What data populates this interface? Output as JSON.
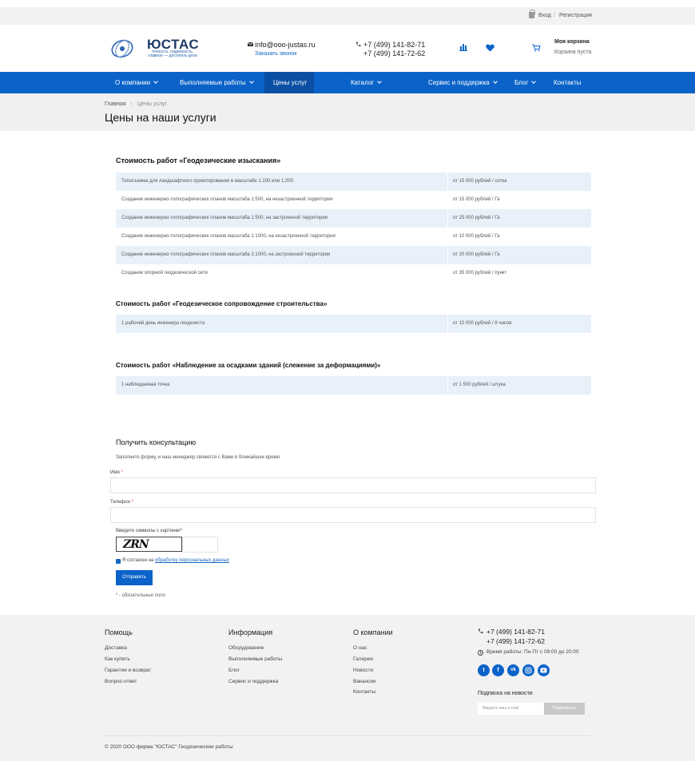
{
  "topbar": {
    "login": "Вход",
    "separator": "/",
    "register": "Регистрация"
  },
  "header": {
    "logo_title": "ЮСТАС",
    "logo_sub1": "точность, надежность,",
    "logo_sub2": "главное — достигать цели",
    "email": "info@ooo-justas.ru",
    "callback": "Заказать звонок",
    "phone1": "+7 (499) 141-82-71",
    "phone2": "+7 (499) 141-72-62",
    "cart_title": "Моя корзина",
    "cart_status": "Корзина пуста"
  },
  "nav": {
    "items": [
      "О компании",
      "Выполняемые работы",
      "Цены услуг",
      "Каталог",
      "Сервис и поддержка",
      "Блог",
      "Контакты"
    ]
  },
  "breadcrumb": {
    "home": "Главная",
    "separator": "›",
    "current": "Цены услуг"
  },
  "page_title": "Цены на наши услуги",
  "sections": [
    {
      "title": "Стоимость работ «Геодезические изыскания»",
      "rows": [
        {
          "service": "Топосъемка для ландшафтного проектирования в масштабе 1:100 или 1:200",
          "price": "от 15 000 рублей / сотка"
        },
        {
          "service": "Создание инженерно-топографических планов масштаба 1:500, на незастроенной территории",
          "price": "от 15 000 рублей / Га"
        },
        {
          "service": "Создание инженерно-топографических планов масштаба 1:500, на застроенной территории",
          "price": "от 25 000 рублей / Га"
        },
        {
          "service": "Создание инженерно-топографических планов масштаба 1:1000, на незастроенной территории",
          "price": "от 10 000 рублей / Га"
        },
        {
          "service": "Создание инженерно-топографических планов масштаба 1:1000, на застроенной территории",
          "price": "от 20 000 рублей / Га"
        },
        {
          "service": "Создание опорной геодезической сети",
          "price": "от 35 000 рублей / пункт"
        }
      ]
    },
    {
      "title": "Стоимость работ «Геодезическое сопровождение строительства»",
      "rows": [
        {
          "service": "1 рабочий день инженера геодезиста",
          "price": "от 10 000 рублей / 8 часов"
        }
      ]
    },
    {
      "title": "Стоимость работ «Наблюдение за осадками зданий (слежение за деформациями)»",
      "rows": [
        {
          "service": "1 наблюдаемая точка",
          "price": "от 1 500 рублей / штука"
        }
      ]
    }
  ],
  "form": {
    "title": "Получить консультацию",
    "description": "Заполните форму, и наш менеджер свяжется с Вами в ближайшее время",
    "name_label": "Имя",
    "phone_label": "Телефон",
    "required_mark": "*",
    "captcha_label": "Введите символы с картинки*",
    "captcha_text": "ZRN",
    "agree_prefix": "Я согласен на",
    "agree_link": "обработку персональных данных",
    "submit_label": "Отправить",
    "required_note": "* - обязательные поля"
  },
  "footer": {
    "col1": {
      "title": "Помощь",
      "links": [
        "Доставка",
        "Как купить",
        "Гарантия и возврат",
        "Вопрос-ответ"
      ]
    },
    "col2": {
      "title": "Информация",
      "links": [
        "Оборудование",
        "Выполняемые работы",
        "Блог",
        "Сервис и поддержка"
      ]
    },
    "col3": {
      "title": "О компании",
      "links": [
        "О нас",
        "Галерея",
        "Новости",
        "Вакансии",
        "Контакты"
      ]
    },
    "phone1": "+7 (499) 141-82-71",
    "phone2": "+7 (499) 141-72-62",
    "hours": "Время работы: Пн-Пт с 09:00 до 20:00",
    "social": [
      "twitter-icon",
      "facebook-icon",
      "vk-icon",
      "instagram-icon",
      "youtube-icon"
    ],
    "subscribe_title": "Подписка на новости",
    "subscribe_placeholder": "Введите ваш e-mail",
    "subscribe_button": "Подписаться",
    "copyright": "© 2020 ООО фирма \"ЮСТАС\" Геодезические работы"
  },
  "colors": {
    "accent": "#0b63c9",
    "nav_active": "#0a4fa3",
    "row_alt": "#e8f1f9"
  }
}
